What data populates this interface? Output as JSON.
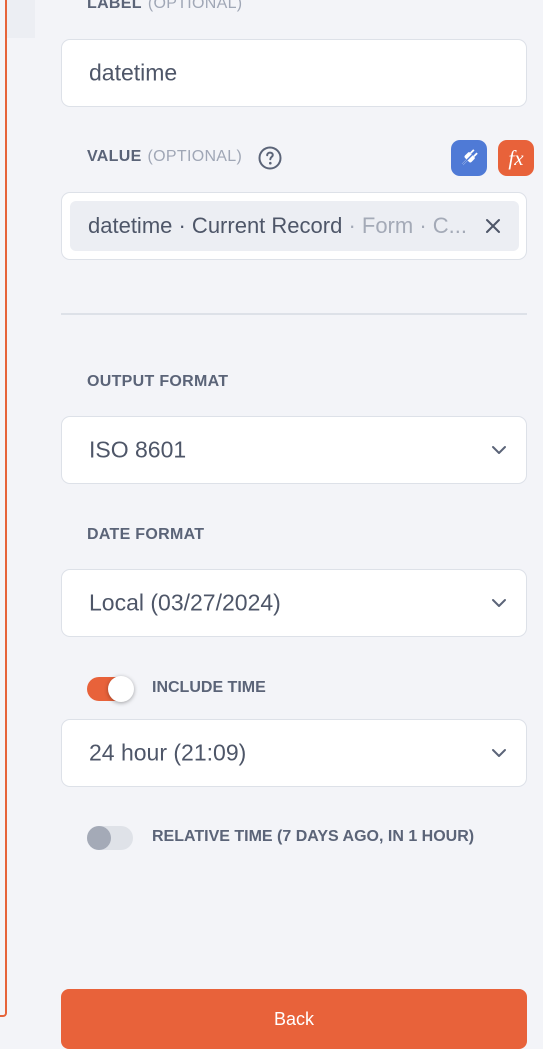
{
  "label_section": {
    "title": "LABEL",
    "optional": "(OPTIONAL)",
    "value": "datetime"
  },
  "value_section": {
    "title": "VALUE",
    "optional": "(OPTIONAL)",
    "help_icon": "question-circle-icon",
    "plugin_icon": "plug-icon",
    "function_icon_label": "fx",
    "chip": {
      "primary": "datetime · Current Record",
      "secondary": " · Form · C..."
    },
    "clear_icon": "close-icon"
  },
  "output_format": {
    "title": "OUTPUT FORMAT",
    "selected": "ISO 8601"
  },
  "date_format": {
    "title": "DATE FORMAT",
    "selected": "Local (03/27/2024)"
  },
  "include_time": {
    "label": "INCLUDE TIME",
    "enabled": true,
    "selected": "24 hour (21:09)"
  },
  "relative_time": {
    "label": "RELATIVE TIME (7 DAYS AGO, IN 1 HOUR)",
    "enabled": false
  },
  "back_button": {
    "label": "Back"
  },
  "colors": {
    "accent": "#e8623a",
    "plugin_badge": "#4f7ad6",
    "background": "#f3f4f8"
  }
}
